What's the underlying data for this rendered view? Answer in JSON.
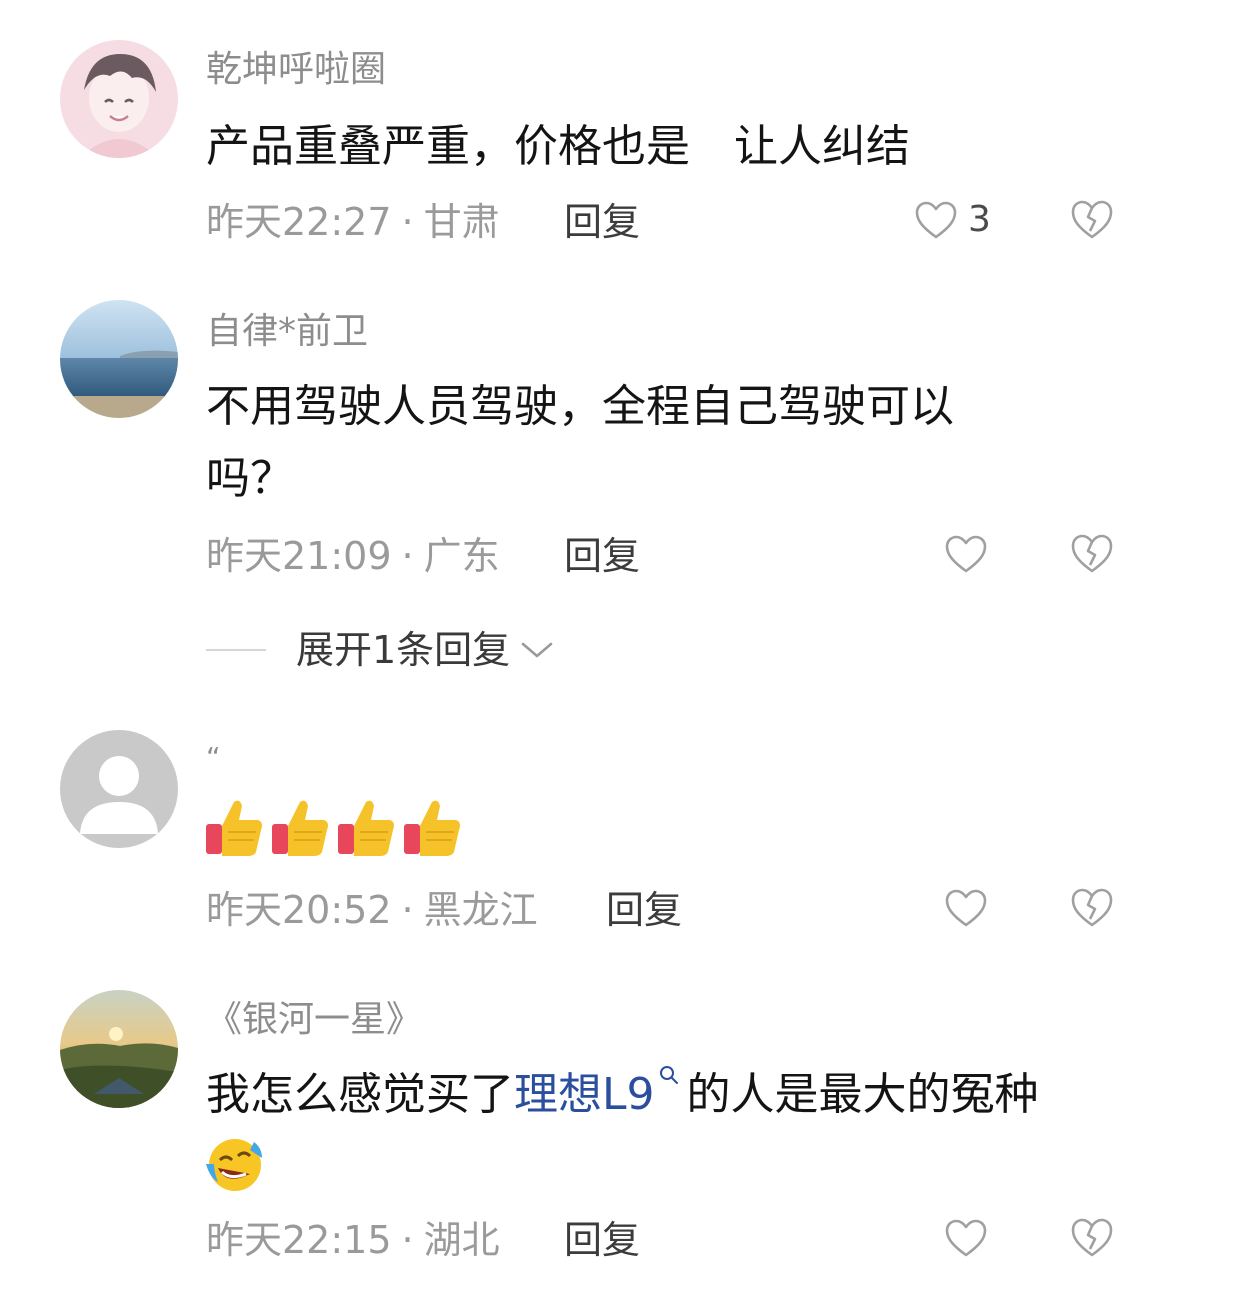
{
  "comments": [
    {
      "username": "乾坤呼啦圈",
      "avatar_icon": "anime-boy-avatar-icon",
      "text": "产品重叠严重，价格也是　让人纠结",
      "time": "昨天22:27",
      "separator": "·",
      "location": "甘肃",
      "reply_label": "回复",
      "like_count": "3"
    },
    {
      "username": "自律*前卫",
      "avatar_icon": "sea-landscape-avatar-icon",
      "text_line1": "不用驾驶人员驾驶，全程自己驾驶可以",
      "text_line2": "吗？",
      "time": "昨天21:09",
      "separator": "·",
      "location": "广东",
      "reply_label": "回复",
      "expand_label": "展开1条回复"
    },
    {
      "username": "“",
      "avatar_icon": "default-user-avatar-icon",
      "emoji": [
        "thumbs-up-icon",
        "thumbs-up-icon",
        "thumbs-up-icon",
        "thumbs-up-icon"
      ],
      "time": "昨天20:52",
      "separator": "·",
      "location": "黑龙江",
      "reply_label": "回复"
    },
    {
      "username": "《银河一星》",
      "avatar_icon": "sunset-landscape-avatar-icon",
      "text_before": "我怎么感觉买了",
      "link_text": "理想L9",
      "text_after": "的人是最大的冤种",
      "emoji": "laughing-tears-icon",
      "time": "昨天22:15",
      "separator": "·",
      "location": "湖北",
      "reply_label": "回复"
    }
  ],
  "colors": {
    "username": "#8d8d8d",
    "content": "#141414",
    "meta": "#9a9a9a",
    "link": "#2b4f9e",
    "icon_stroke": "#a0a0a0"
  }
}
